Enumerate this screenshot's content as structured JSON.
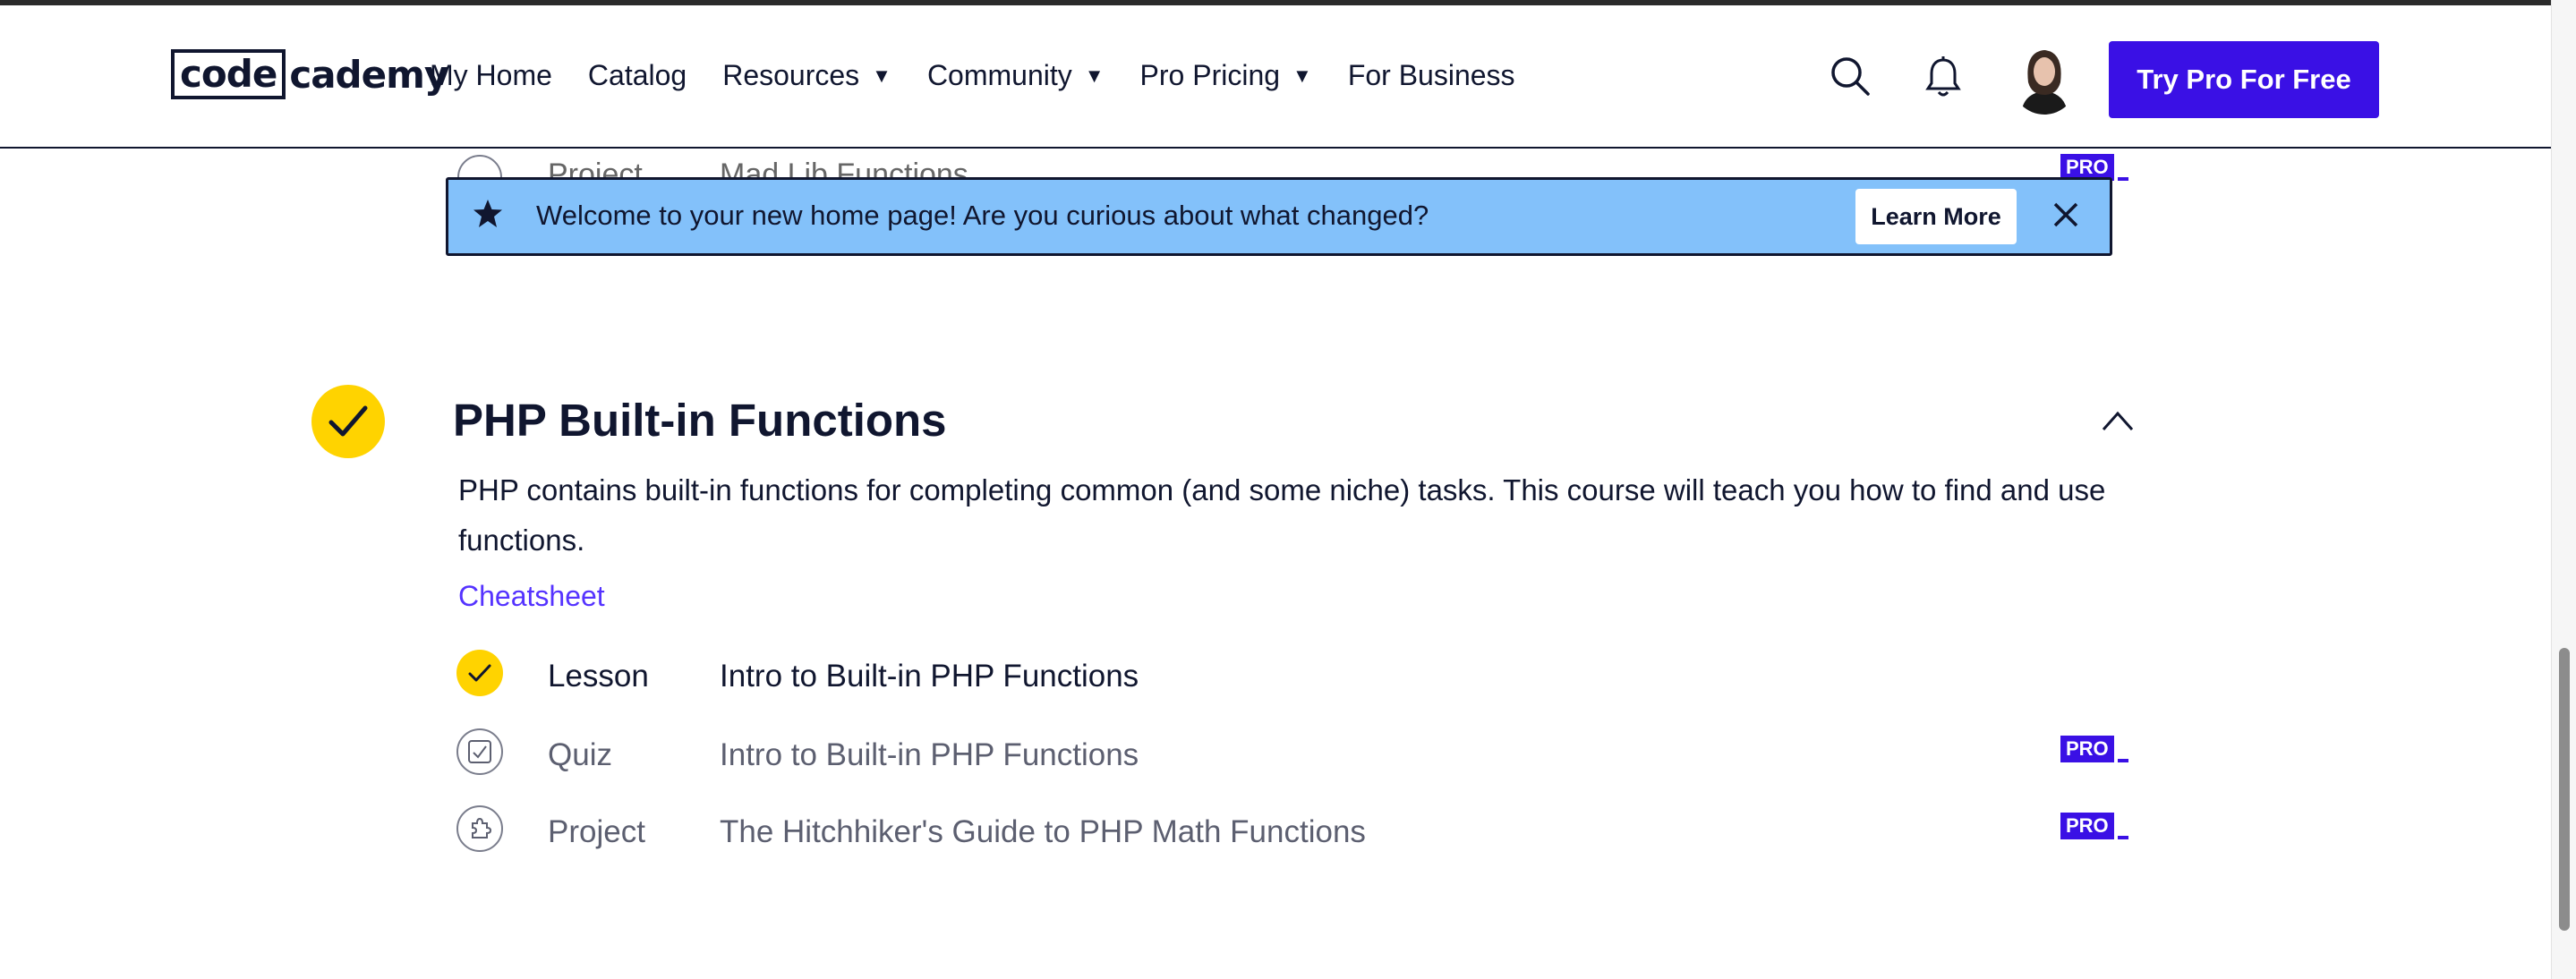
{
  "header": {
    "logo_left": "code",
    "logo_right": "cademy",
    "nav": [
      {
        "label": "My Home",
        "dropdown": false
      },
      {
        "label": "Catalog",
        "dropdown": false
      },
      {
        "label": "Resources",
        "dropdown": true
      },
      {
        "label": "Community",
        "dropdown": true
      },
      {
        "label": "Pro Pricing",
        "dropdown": true
      },
      {
        "label": "For Business",
        "dropdown": false
      }
    ],
    "caret": "▼",
    "cta": "Try Pro For Free",
    "icons": [
      "search-icon",
      "bell-icon",
      "avatar"
    ]
  },
  "faded_row": {
    "type": "Project",
    "title": "Mad Lib Functions",
    "badge": "PRO"
  },
  "banner": {
    "message": "Welcome to your new home page! Are you curious about what changed?",
    "button": "Learn More",
    "icons": [
      "star-icon",
      "close-icon"
    ]
  },
  "module": {
    "title": "PHP Built-in Functions",
    "description": "PHP contains built-in functions for completing common (and some niche) tasks. This course will teach you how to find and use functions.",
    "cheatsheet": "Cheatsheet",
    "completed": true,
    "items": [
      {
        "type": "Lesson",
        "title": "Intro to Built-in PHP Functions",
        "completed": true,
        "badge": ""
      },
      {
        "type": "Quiz",
        "title": "Intro to Built-in PHP Functions",
        "completed": false,
        "badge": "PRO"
      },
      {
        "type": "Project",
        "title": "The Hitchhiker's Guide to PHP Math Functions",
        "completed": false,
        "badge": "PRO"
      }
    ]
  },
  "colors": {
    "accent": "#3a10e5",
    "banner": "#83c1fa",
    "check": "#ffd300",
    "text": "#10162f"
  }
}
